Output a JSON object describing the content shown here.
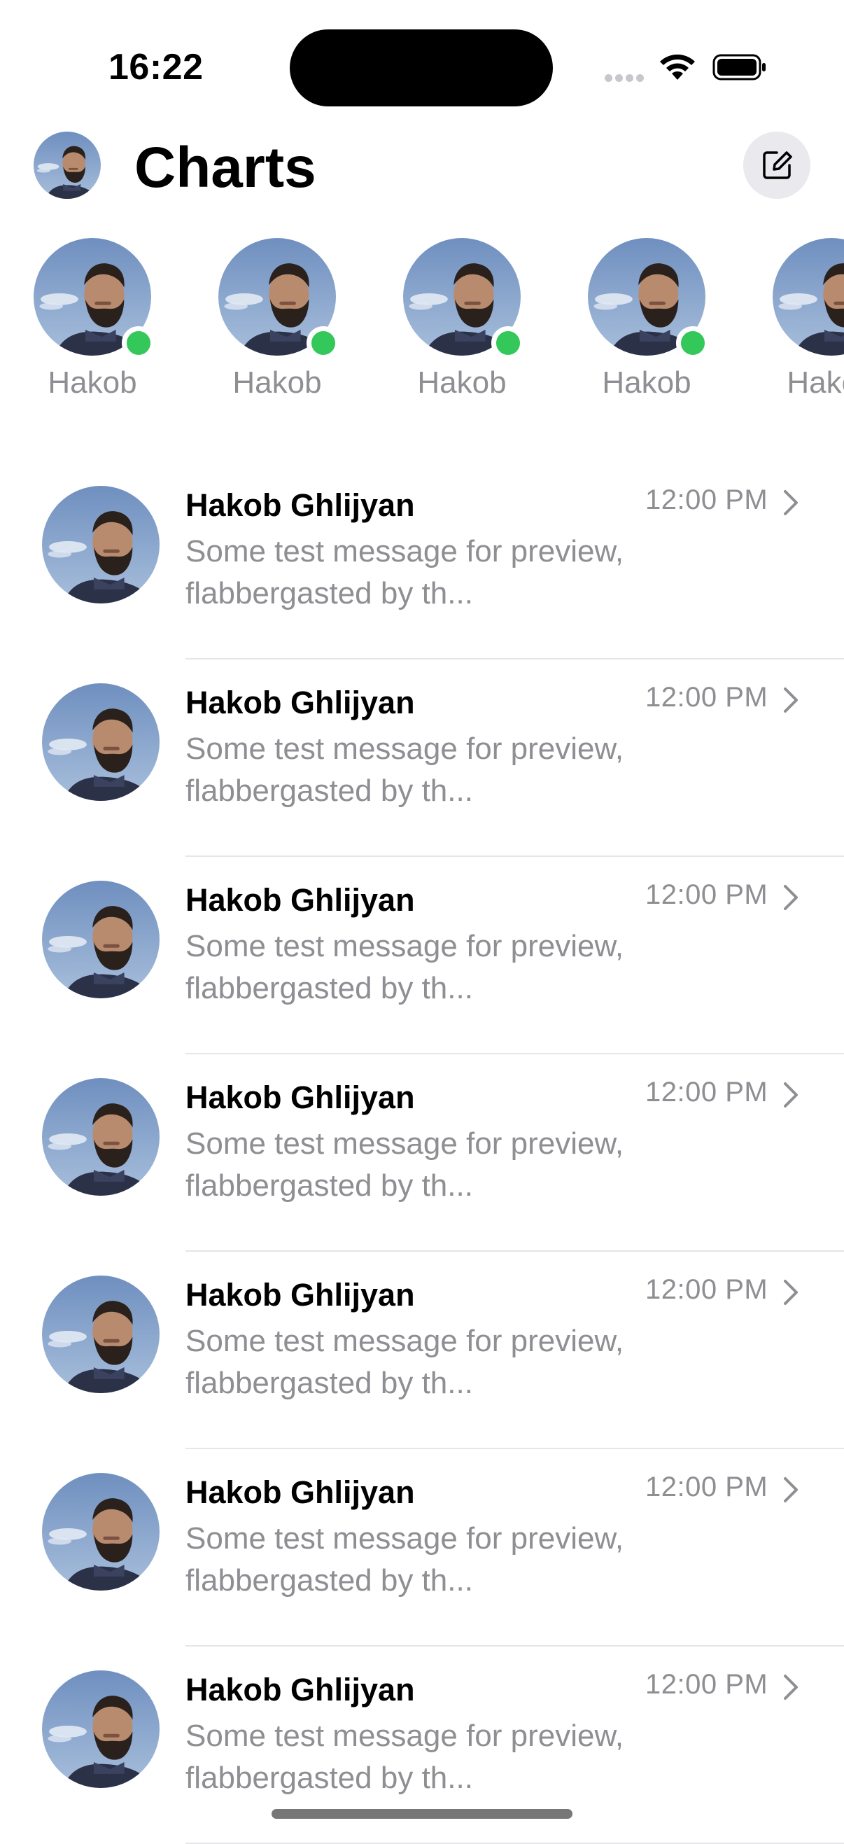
{
  "status_bar": {
    "time": "16:22"
  },
  "header": {
    "title": "Charts"
  },
  "stories": [
    {
      "name": "Hakob",
      "online": true
    },
    {
      "name": "Hakob",
      "online": true
    },
    {
      "name": "Hakob",
      "online": true
    },
    {
      "name": "Hakob",
      "online": true
    },
    {
      "name": "Hakob",
      "online": false
    }
  ],
  "chats": [
    {
      "name": "Hakob Ghlijyan",
      "time": "12:00 PM",
      "preview": "Some test message for preview, flabbergasted by th..."
    },
    {
      "name": "Hakob Ghlijyan",
      "time": "12:00 PM",
      "preview": "Some test message for preview, flabbergasted by th..."
    },
    {
      "name": "Hakob Ghlijyan",
      "time": "12:00 PM",
      "preview": "Some test message for preview, flabbergasted by th..."
    },
    {
      "name": "Hakob Ghlijyan",
      "time": "12:00 PM",
      "preview": "Some test message for preview, flabbergasted by th..."
    },
    {
      "name": "Hakob Ghlijyan",
      "time": "12:00 PM",
      "preview": "Some test message for preview, flabbergasted by th..."
    },
    {
      "name": "Hakob Ghlijyan",
      "time": "12:00 PM",
      "preview": "Some test message for preview, flabbergasted by th..."
    },
    {
      "name": "Hakob Ghlijyan",
      "time": "12:00 PM",
      "preview": "Some test message for preview, flabbergasted by th..."
    }
  ],
  "icons": {
    "compose": "square-and-pencil-icon",
    "chevron": "chevron-right-icon",
    "wifi": "wifi-icon",
    "battery": "battery-icon"
  },
  "colors": {
    "online": "#34c759",
    "secondary_text": "#8e8e93",
    "divider": "#e5e5ea"
  }
}
